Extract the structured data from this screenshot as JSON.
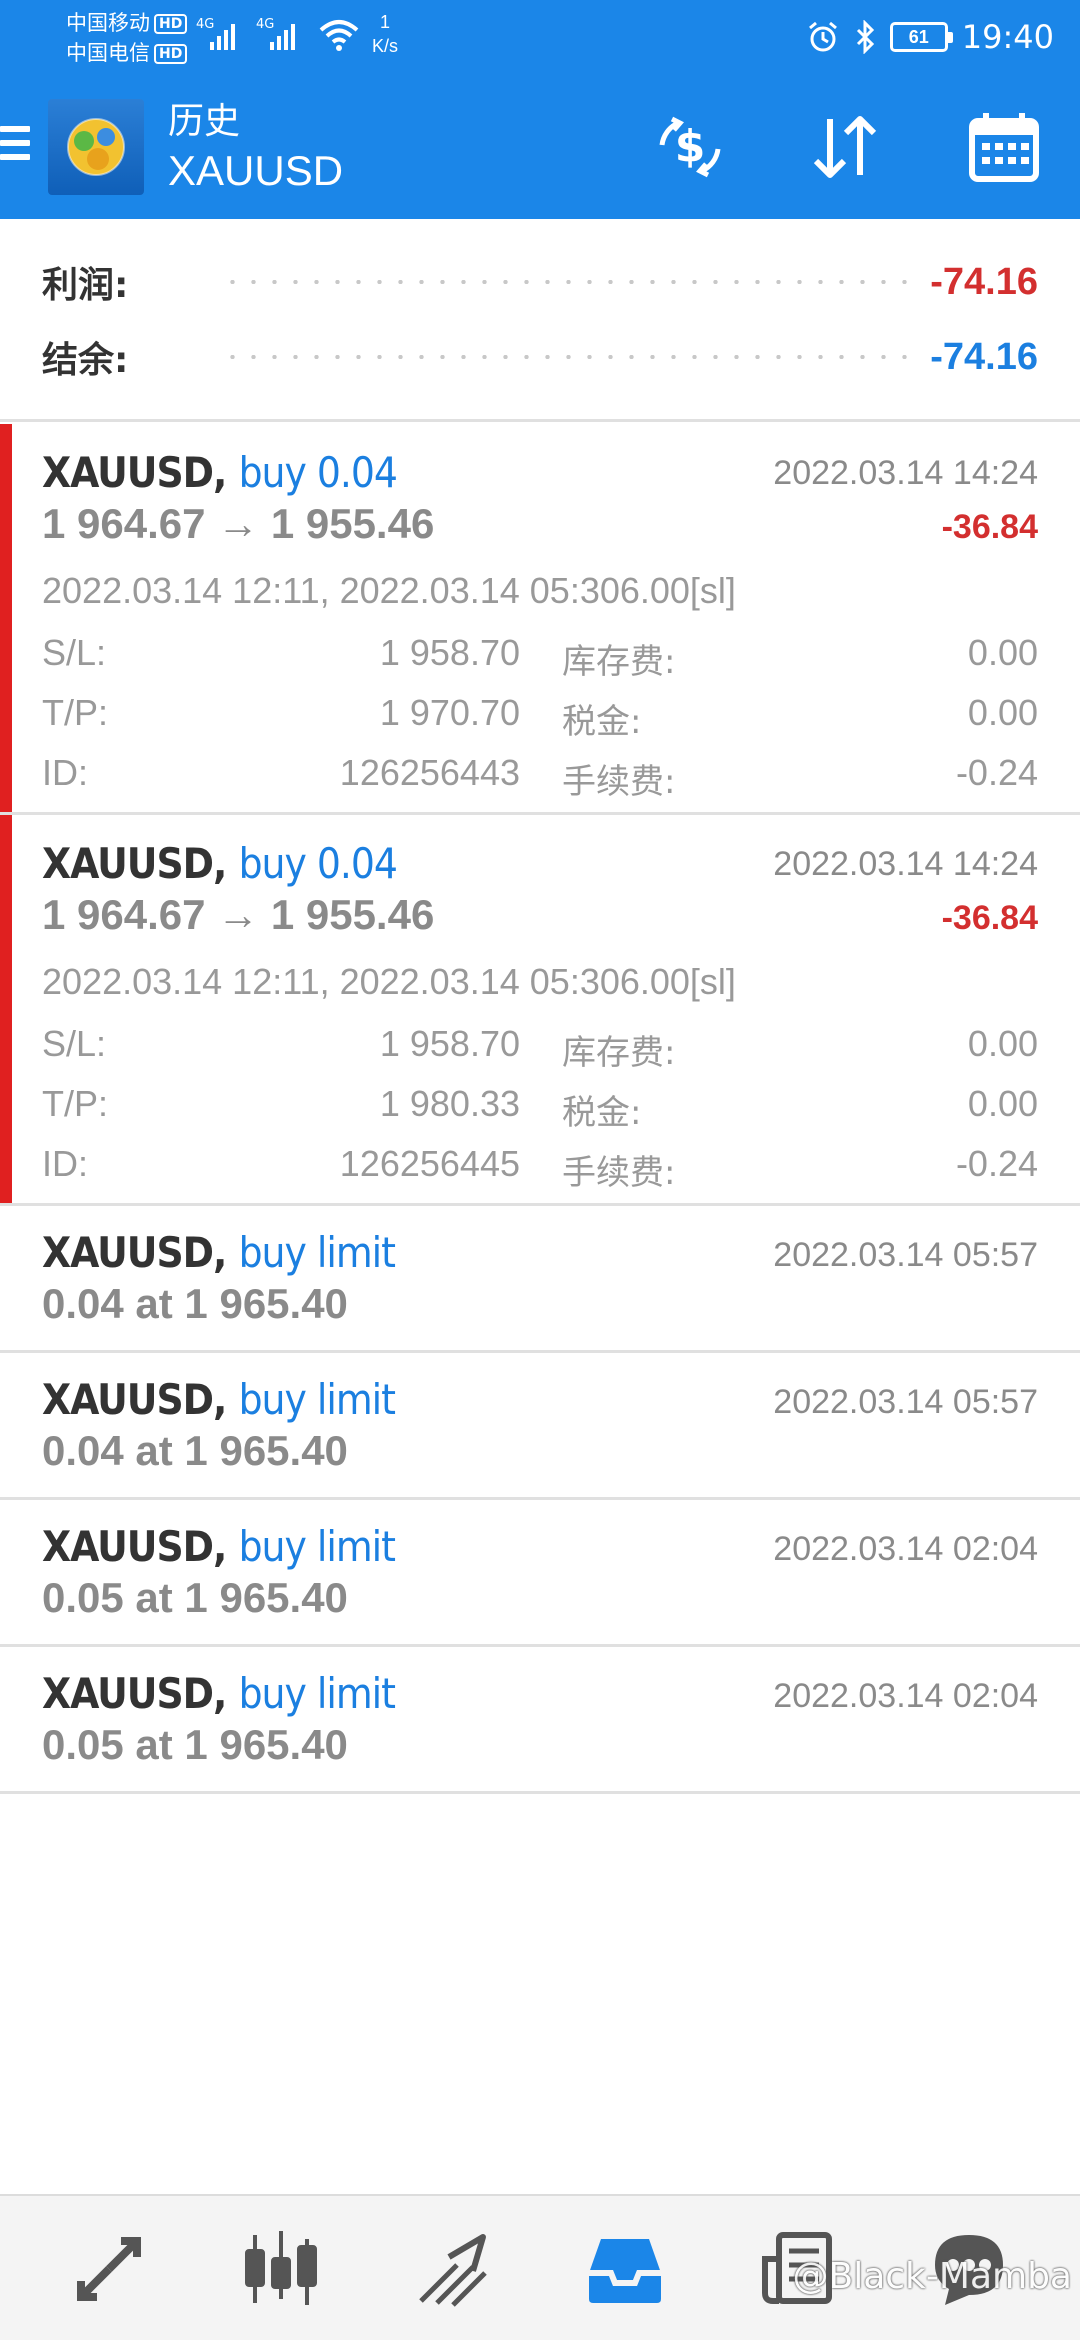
{
  "status_bar": {
    "carrier1": "中国移动",
    "carrier2": "中国电信",
    "hd": "HD",
    "net1": "4G",
    "net2": "4G",
    "speed_value": "1",
    "speed_unit": "K/s",
    "battery": "61",
    "time": "19:40"
  },
  "app_bar": {
    "title": "历史",
    "subtitle": "XAUUSD",
    "icons": [
      "currency-exchange-icon",
      "sort-icon",
      "calendar-icon"
    ]
  },
  "summary": {
    "profit_label": "利润:",
    "profit_value": "-74.16",
    "balance_label": "结余:",
    "balance_value": "-74.16"
  },
  "deals": [
    {
      "symbol": "XAUUSD,",
      "type": "buy 0.04",
      "time": "2022.03.14 14:24",
      "prices": "1 964.67 → 1 955.46",
      "profit": "-36.84",
      "dates": "2022.03.14 12:11, 2022.03.14 05:306.00[sl]",
      "sl_label": "S/L:",
      "sl": "1 958.70",
      "swap_label": "库存费:",
      "swap": "0.00",
      "tp_label": "T/P:",
      "tp": "1 970.70",
      "tax_label": "税金:",
      "tax": "0.00",
      "id_label": "ID:",
      "id": "126256443",
      "fee_label": "手续费:",
      "fee": "-0.24"
    },
    {
      "symbol": "XAUUSD,",
      "type": "buy 0.04",
      "time": "2022.03.14 14:24",
      "prices": "1 964.67 → 1 955.46",
      "profit": "-36.84",
      "dates": "2022.03.14 12:11, 2022.03.14 05:306.00[sl]",
      "sl_label": "S/L:",
      "sl": "1 958.70",
      "swap_label": "库存费:",
      "swap": "0.00",
      "tp_label": "T/P:",
      "tp": "1 980.33",
      "tax_label": "税金:",
      "tax": "0.00",
      "id_label": "ID:",
      "id": "126256445",
      "fee_label": "手续费:",
      "fee": "-0.24"
    }
  ],
  "orders": [
    {
      "symbol": "XAUUSD,",
      "type": "buy limit",
      "time": "2022.03.14 05:57",
      "line": "0.04 at 1 965.40"
    },
    {
      "symbol": "XAUUSD,",
      "type": "buy limit",
      "time": "2022.03.14 05:57",
      "line": "0.04 at 1 965.40"
    },
    {
      "symbol": "XAUUSD,",
      "type": "buy limit",
      "time": "2022.03.14 02:04",
      "line": "0.05 at 1 965.40"
    },
    {
      "symbol": "XAUUSD,",
      "type": "buy limit",
      "time": "2022.03.14 02:04",
      "line": "0.05 at 1 965.40"
    }
  ],
  "bottom_nav": {
    "items": [
      "quotes-icon",
      "chart-icon",
      "trade-icon",
      "history-icon",
      "news-icon",
      "messages-icon"
    ],
    "active": "history-icon",
    "watermark": "@Black-Mamba"
  },
  "colors": {
    "primary": "#1b86e8",
    "loss": "#d32f2f",
    "accent_blue": "#1b7fe0",
    "deal_bar": "#e02020"
  }
}
